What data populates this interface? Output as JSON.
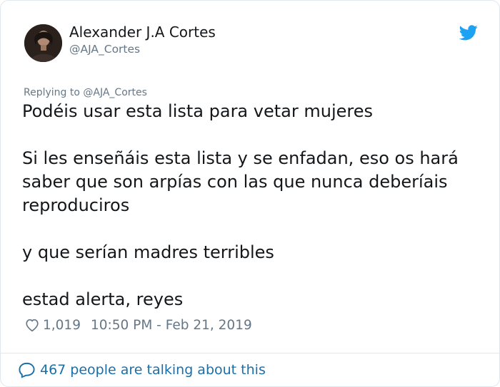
{
  "user": {
    "display_name": "Alexander J.A Cortes",
    "handle": "@AJA_Cortes",
    "avatar_icon": "user-avatar"
  },
  "tweet": {
    "reply_context": "Replying to @AJA_Cortes",
    "paragraphs": [
      "Podéis usar esta lista para vetar mujeres",
      "Si les enseñáis esta lista y se enfadan, eso os hará",
      "saber que son arpías con las que nunca deberíais",
      "reproduciros",
      "y que serían madres terribles",
      "estad alerta, reyes"
    ],
    "like_count": "1,019",
    "timestamp": "10:50 PM - Feb 21, 2019"
  },
  "footer": {
    "talking_label": "467 people are talking about this"
  },
  "icons": {
    "brand": "twitter-bird-icon",
    "like": "heart-icon",
    "conversation": "speech-bubble-icon"
  },
  "colors": {
    "brand_blue": "#1da1f2",
    "link_blue": "#1b6fa8",
    "secondary_text": "#657786",
    "border": "#e1e8ed"
  }
}
